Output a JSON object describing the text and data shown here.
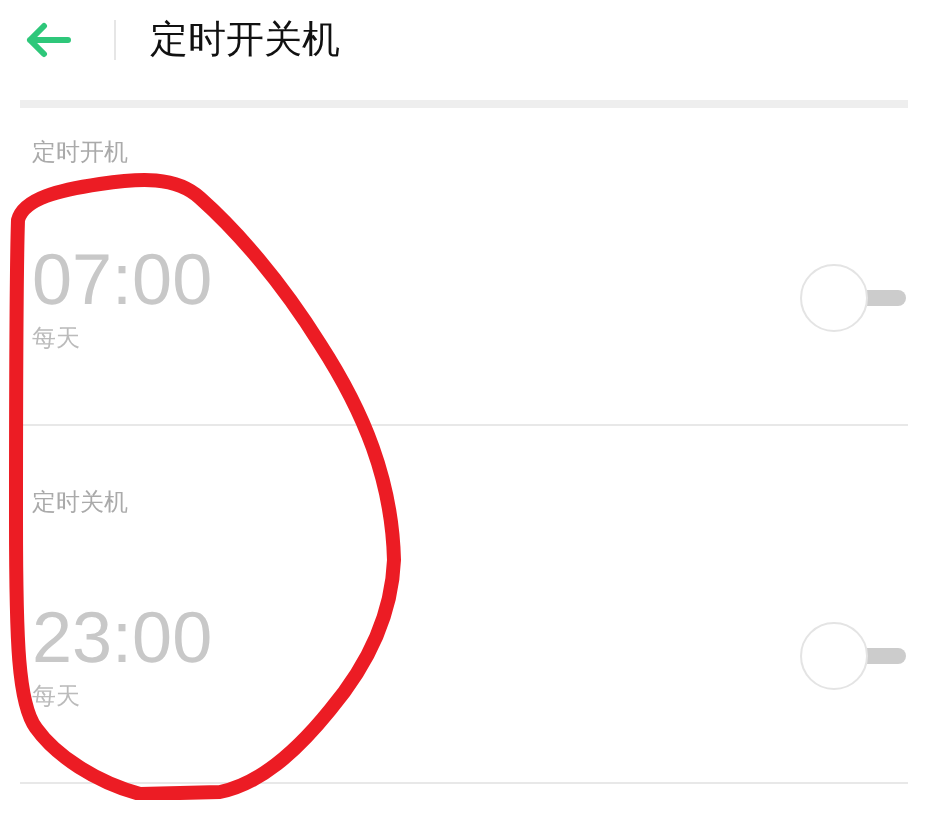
{
  "header": {
    "title": "定时开关机"
  },
  "timers": [
    {
      "section_label": "定时开机",
      "time": "07:00",
      "repeat": "每天",
      "on": false
    },
    {
      "section_label": "定时关机",
      "time": "23:00",
      "repeat": "每天",
      "on": false
    }
  ],
  "annotation": {
    "kind": "loop"
  }
}
